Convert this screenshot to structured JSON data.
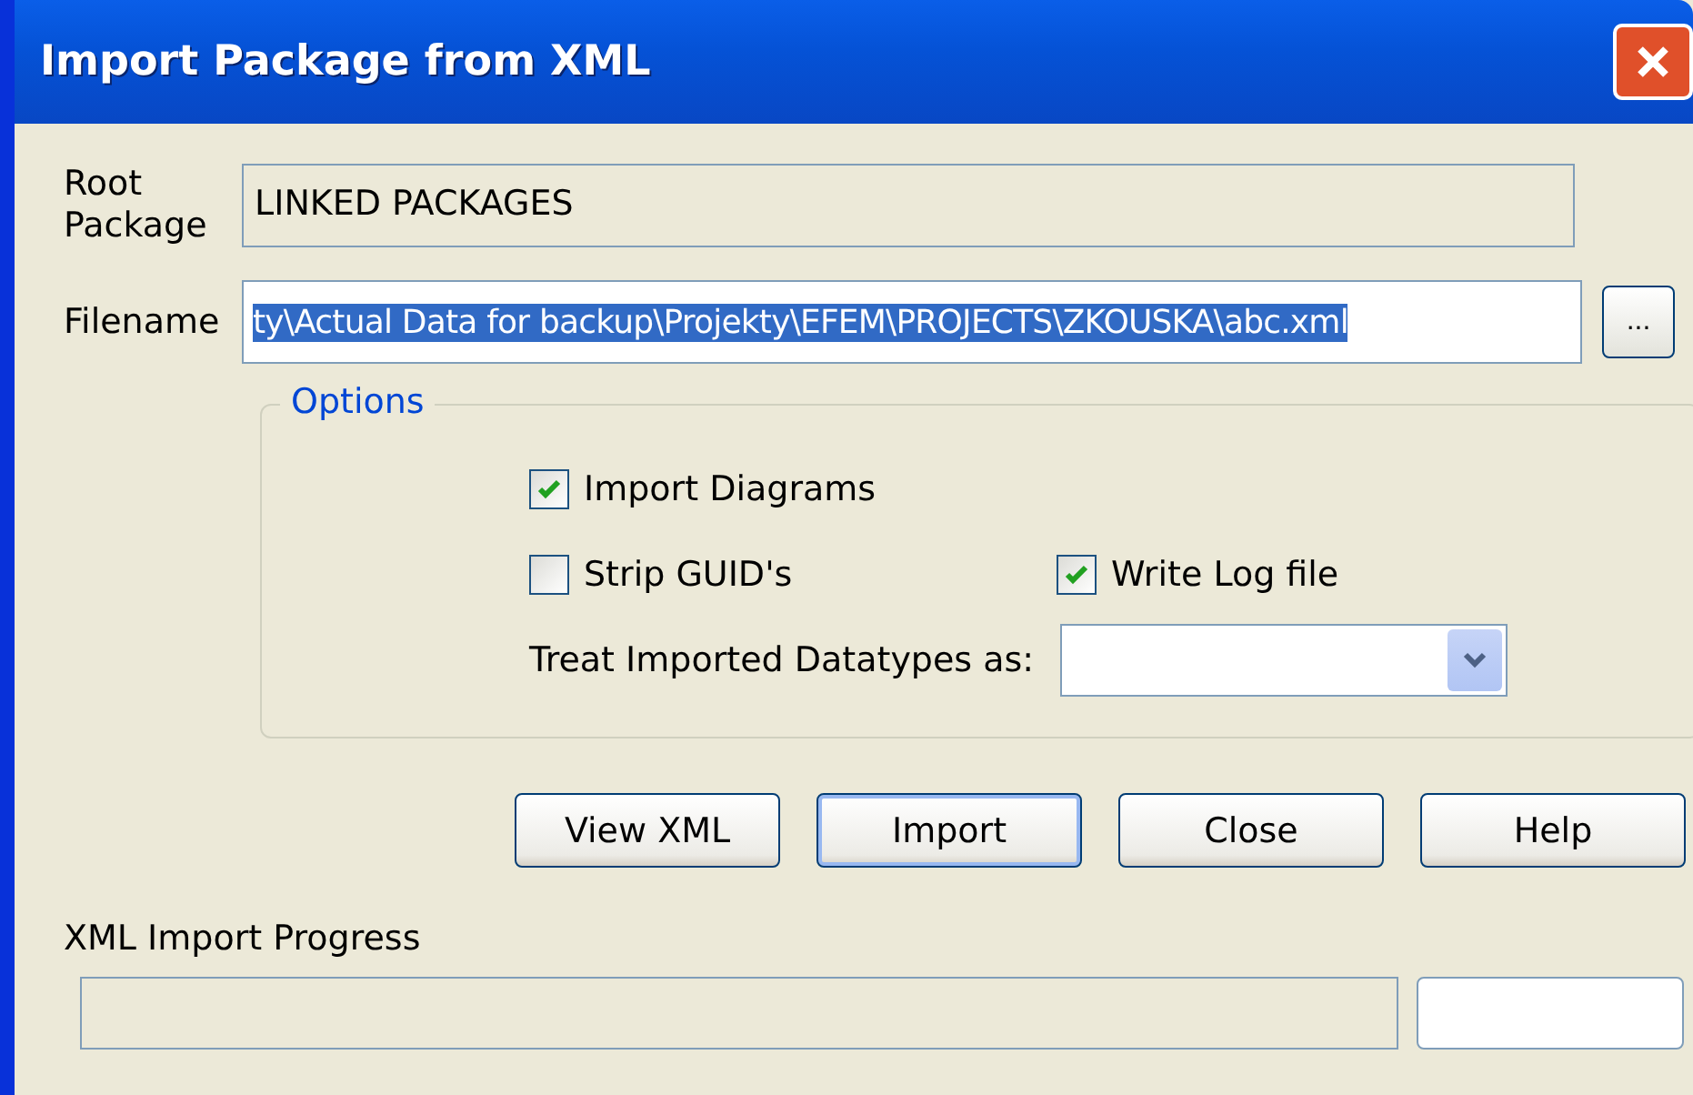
{
  "window": {
    "title": "Import Package from XML"
  },
  "root_package": {
    "label": "Root Package",
    "value": "LINKED PACKAGES",
    "disabled": true
  },
  "filename": {
    "label": "Filename",
    "value": "ty\\Actual Data for backup\\Projekty\\EFEM\\PROJECTS\\ZKOUSKA\\abc.xml",
    "selected": true,
    "browse": "..."
  },
  "options": {
    "title": "Options",
    "checkboxes": [
      {
        "label": "Import Diagrams",
        "checked": true
      },
      {
        "label": "Strip GUID's",
        "checked": false
      },
      {
        "label": "Write Log file",
        "checked": true
      }
    ],
    "datatypes": {
      "label": "Treat Imported Datatypes as:"
    }
  },
  "buttons": [
    {
      "label": "View XML",
      "default": false
    },
    {
      "label": "Import",
      "default": true
    },
    {
      "label": "Close",
      "default": false
    },
    {
      "label": "Help",
      "default": false
    }
  ],
  "progress": {
    "label": "XML Import Progress"
  }
}
